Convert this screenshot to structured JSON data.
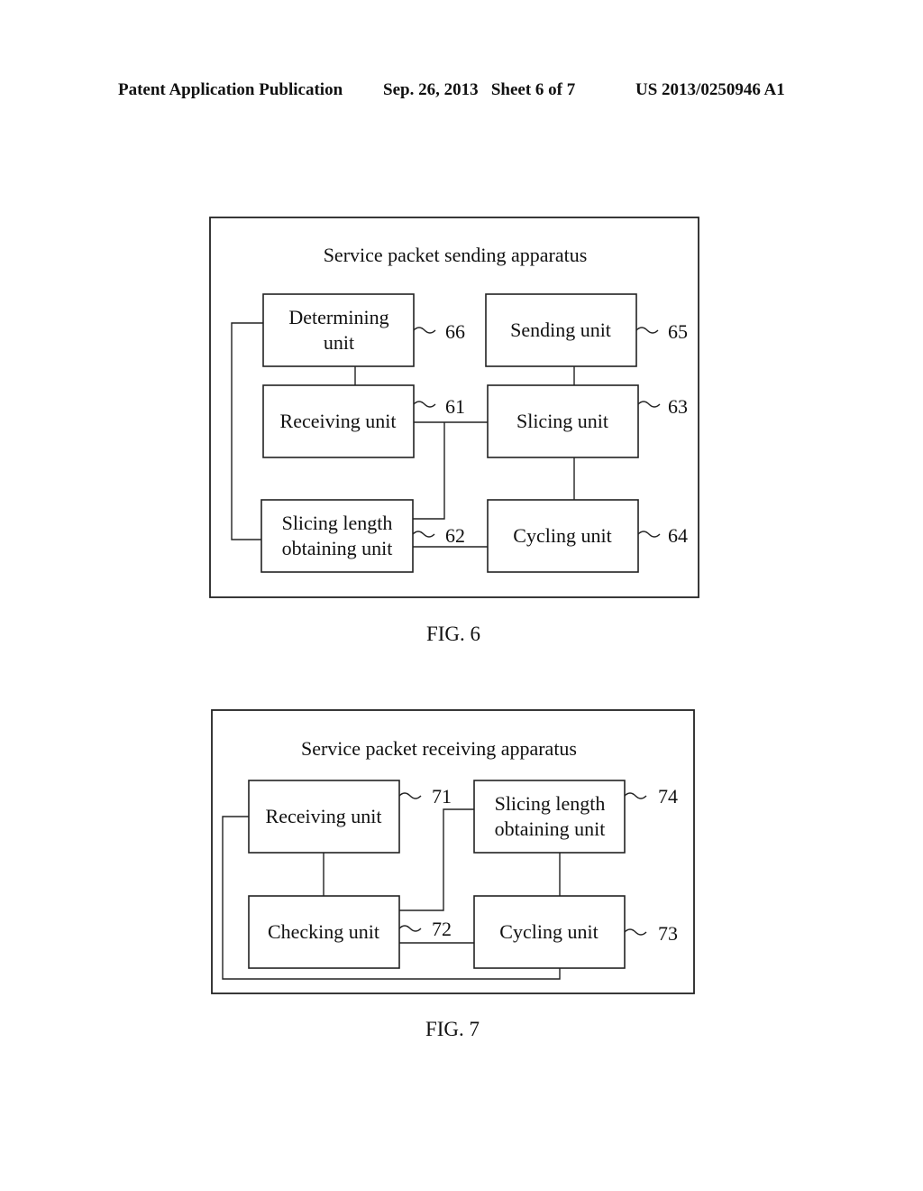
{
  "header": {
    "left": "Patent Application Publication",
    "middle": "Sep. 26, 2013   Sheet 6 of 7",
    "right": "US 2013/0250946 A1"
  },
  "fig6": {
    "title": "Service packet sending apparatus",
    "caption": "FIG. 6",
    "units": {
      "determining": {
        "lines": [
          "Determining",
          "unit"
        ],
        "ref": "66"
      },
      "sending": {
        "lines": [
          "Sending unit"
        ],
        "ref": "65"
      },
      "receiving": {
        "lines": [
          "Receiving unit"
        ],
        "ref": "61"
      },
      "slicing": {
        "lines": [
          "Slicing unit"
        ],
        "ref": "63"
      },
      "slicing_length": {
        "lines": [
          "Slicing length",
          "obtaining unit"
        ],
        "ref": "62"
      },
      "cycling": {
        "lines": [
          "Cycling unit"
        ],
        "ref": "64"
      }
    }
  },
  "fig7": {
    "title": "Service packet receiving apparatus",
    "caption": "FIG. 7",
    "units": {
      "receiving": {
        "lines": [
          "Receiving unit"
        ],
        "ref": "71"
      },
      "slicing_length": {
        "lines": [
          "Slicing length",
          "obtaining unit"
        ],
        "ref": "74"
      },
      "checking": {
        "lines": [
          "Checking unit"
        ],
        "ref": "72"
      },
      "cycling": {
        "lines": [
          "Cycling unit"
        ],
        "ref": "73"
      }
    }
  }
}
